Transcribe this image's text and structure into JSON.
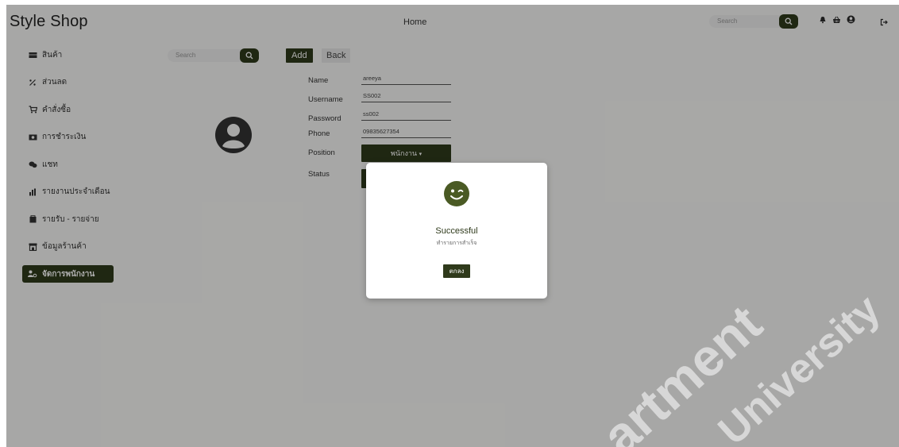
{
  "header": {
    "brand": "Style Shop",
    "center_label": "Home",
    "search_placeholder": "Search",
    "icons": [
      "bell-icon",
      "basket-icon",
      "user-circle-icon",
      "logout-icon"
    ]
  },
  "sidebar": {
    "items": [
      {
        "label": "สินค้า",
        "icon": "box-icon"
      },
      {
        "label": "ส่วนลด",
        "icon": "percent-icon"
      },
      {
        "label": "คำสั่งซื้อ",
        "icon": "cart-icon"
      },
      {
        "label": "การชำระเงิน",
        "icon": "money-icon"
      },
      {
        "label": "แชท",
        "icon": "chat-icon"
      },
      {
        "label": "รายงานประจำเดือน",
        "icon": "bar-chart-icon"
      },
      {
        "label": "รายรับ - รายจ่าย",
        "icon": "wallet-icon"
      },
      {
        "label": "ข้อมูลร้านค้า",
        "icon": "store-icon"
      },
      {
        "label": "จัดการพนักงาน",
        "icon": "users-icon",
        "active": true
      }
    ]
  },
  "main": {
    "search_placeholder": "Search",
    "add_label": "Add",
    "back_label": "Back",
    "form": {
      "name_label": "Name",
      "name_value": "areeya",
      "username_label": "Username",
      "username_value": "SS002",
      "password_label": "Password",
      "password_value": "ss002",
      "phone_label": "Phone",
      "phone_value": "09835627354",
      "position_label": "Position",
      "position_value": "พนักงาน",
      "status_label": "Status"
    }
  },
  "modal": {
    "title": "Successful",
    "message": "ทำรายการสำเร็จ",
    "ok_label": "ตกลง"
  },
  "watermark": {
    "line1": "artment",
    "line2": "University"
  },
  "colors": {
    "accent": "#2f3a1b",
    "overlay": "#000000"
  }
}
